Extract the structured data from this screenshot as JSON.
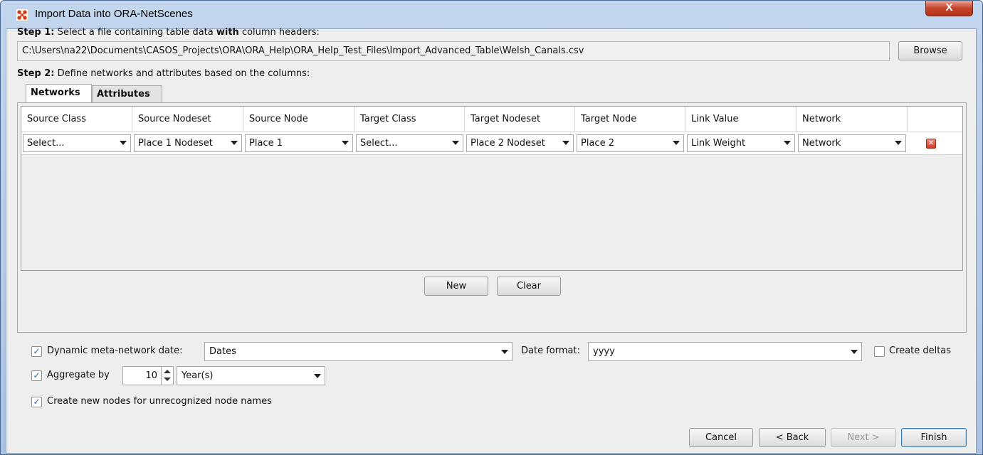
{
  "window": {
    "title": "Import Data into ORA-NetScenes",
    "close_label": "X"
  },
  "step1": {
    "label": "Step 1:",
    "text_pre": "Select a file containing table data ",
    "text_bold": "with",
    "text_post": " column headers:",
    "file_path": "C:\\Users\\na22\\Documents\\CASOS_Projects\\ORA\\ORA_Help\\ORA_Help_Test_Files\\Import_Advanced_Table\\Welsh_Canals.csv",
    "browse_label": "Browse"
  },
  "step2": {
    "label": "Step 2:",
    "text": "Define networks and attributes based on the columns:"
  },
  "tabs": [
    {
      "label": "Networks",
      "active": true
    },
    {
      "label": "Attributes",
      "active": false
    }
  ],
  "networks_table": {
    "columns": [
      "Source Class",
      "Source Nodeset",
      "Source Node",
      "Target Class",
      "Target Nodeset",
      "Target Node",
      "Link Value",
      "Network"
    ],
    "rows": [
      [
        "Select...",
        "Place 1 Nodeset",
        "Place 1",
        "Select...",
        "Place 2 Nodeset",
        "Place 2",
        "Link Weight",
        "Network"
      ]
    ],
    "new_label": "New",
    "clear_label": "Clear"
  },
  "options": {
    "dynamic_label": "Dynamic meta-network date:",
    "dynamic_checked": true,
    "dynamic_value": "Dates",
    "date_format_label": "Date format:",
    "date_format_value": "yyyy",
    "create_deltas_label": "Create deltas",
    "create_deltas_checked": false,
    "aggregate_label": "Aggregate by",
    "aggregate_checked": true,
    "aggregate_value": "10",
    "aggregate_unit": "Year(s)",
    "create_nodes_label": "Create new nodes for unrecognized node names",
    "create_nodes_checked": true
  },
  "footer": {
    "cancel_label": "Cancel",
    "back_label": "< Back",
    "next_label": "Next >",
    "finish_label": "Finish"
  }
}
